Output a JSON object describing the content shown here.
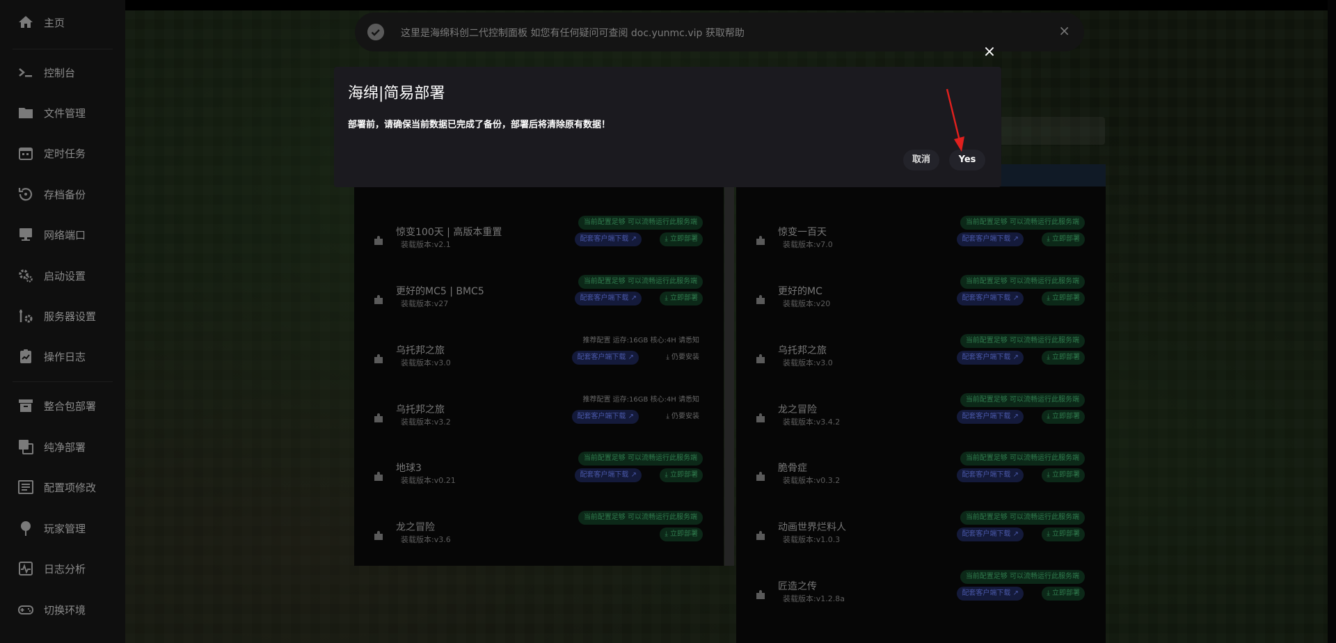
{
  "sidebar": {
    "items": [
      {
        "label": "主页",
        "icon": "home-icon"
      },
      {
        "label": "控制台",
        "icon": "terminal-icon"
      },
      {
        "label": "文件管理",
        "icon": "folder-icon"
      },
      {
        "label": "定时任务",
        "icon": "calendar-icon"
      },
      {
        "label": "存档备份",
        "icon": "backup-icon"
      },
      {
        "label": "网络端口",
        "icon": "monitor-icon"
      },
      {
        "label": "启动设置",
        "icon": "gears-icon"
      },
      {
        "label": "服务器设置",
        "icon": "wrench-icon"
      },
      {
        "label": "操作日志",
        "icon": "clipboard-chart-icon"
      },
      {
        "label": "整合包部署",
        "icon": "archive-icon"
      },
      {
        "label": "纯净部署",
        "icon": "copy-icon"
      },
      {
        "label": "配置项修改",
        "icon": "list-box-icon"
      },
      {
        "label": "玩家管理",
        "icon": "map-pin-icon"
      },
      {
        "label": "日志分析",
        "icon": "activity-icon"
      },
      {
        "label": "切换环境",
        "icon": "gamepad-icon"
      }
    ]
  },
  "notice": {
    "text": "这里是海绵科创二代控制面板 如您有任何疑问可查阅 doc.yunmc.vip 获取帮助",
    "close": "×"
  },
  "modal": {
    "title": "海绵|简易部署",
    "message": "部署前，请确保当前数据已完成了备份，部署后将清除原有数据！",
    "cancel_label": "取消",
    "confirm_label": "Yes",
    "close": "×"
  },
  "packs_left": [
    {
      "name": "惊变100天 | 高版本重置",
      "version": "装载版本:v2.1",
      "status": "当前配置足够 可以流畅运行此服务端",
      "client": "配套客户端下载 ↗",
      "action": "⤓ 立即部署"
    },
    {
      "name": "更好的MC5 | BMC5",
      "version": "装载版本:v27",
      "status": "当前配置足够 可以流畅运行此服务端",
      "client": "配套客户端下载 ↗",
      "action": "⤓ 立即部署"
    },
    {
      "name": "乌托邦之旅",
      "version": "装载版本:v3.0",
      "req": "推荐配置 运存:16GB 核心:4H 请悉知",
      "client": "配套客户端下载 ↗",
      "action": "⤓ 仍要安装"
    },
    {
      "name": "乌托邦之旅",
      "version": "装载版本:v3.2",
      "req": "推荐配置 运存:16GB 核心:4H 请悉知",
      "client": "配套客户端下载 ↗",
      "action": "⤓ 仍要安装"
    },
    {
      "name": "地球3",
      "version": "装载版本:v0.21",
      "status": "当前配置足够 可以流畅运行此服务端",
      "client": "配套客户端下载 ↗",
      "action": "⤓ 立即部署"
    },
    {
      "name": "龙之冒险",
      "version": "装载版本:v3.6",
      "status": "当前配置足够 可以流畅运行此服务端",
      "action": "⤓ 立即部署"
    }
  ],
  "packs_right": [
    {
      "name": "惊变一百天",
      "version": "装载版本:v7.0",
      "status": "当前配置足够 可以流畅运行此服务端",
      "client": "配套客户端下载 ↗",
      "action": "⤓ 立即部署"
    },
    {
      "name": "更好的MC",
      "version": "装载版本:v20",
      "status": "当前配置足够 可以流畅运行此服务端",
      "client": "配套客户端下载 ↗",
      "action": "⤓ 立即部署"
    },
    {
      "name": "乌托邦之旅",
      "version": "装载版本:v3.0",
      "status": "当前配置足够 可以流畅运行此服务端",
      "client": "配套客户端下载 ↗",
      "action": "⤓ 立即部署"
    },
    {
      "name": "龙之冒险",
      "version": "装载版本:v3.4.2",
      "status": "当前配置足够 可以流畅运行此服务端",
      "client": "配套客户端下载 ↗",
      "action": "⤓ 立即部署"
    },
    {
      "name": "脆骨症",
      "version": "装载版本:v0.3.2",
      "status": "当前配置足够 可以流畅运行此服务端",
      "client": "配套客户端下载 ↗",
      "action": "⤓ 立即部署"
    },
    {
      "name": "动画世界烂料人",
      "version": "装载版本:v1.0.3",
      "status": "当前配置足够 可以流畅运行此服务端",
      "client": "配套客户端下载 ↗",
      "action": "⤓ 立即部署"
    },
    {
      "name": "匠造之传",
      "version": "装载版本:v1.2.8a",
      "status": "当前配置足够 可以流畅运行此服务端",
      "client": "配套客户端下载 ↗",
      "action": "⤓ 立即部署"
    }
  ],
  "colors": {
    "arrow": "#e0201e",
    "sidebar_bg": "#0f0f0f",
    "modal_bg": "#1b1a1f"
  }
}
